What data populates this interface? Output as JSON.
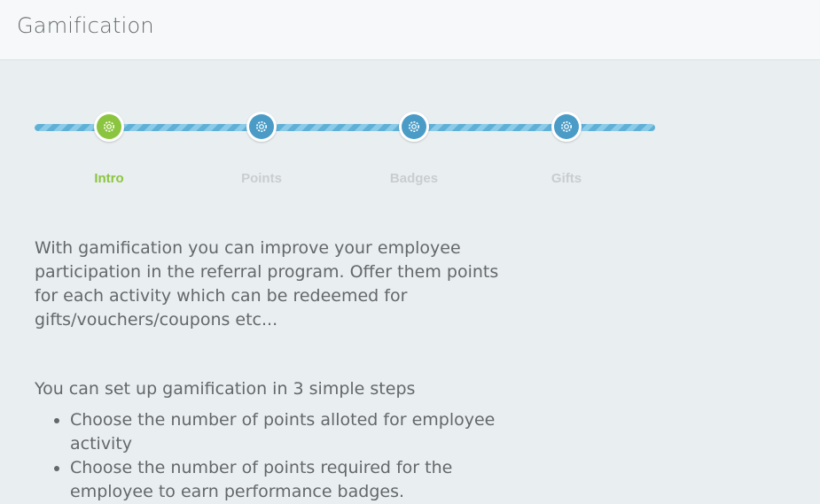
{
  "header": {
    "title": "Gamification"
  },
  "wizard": {
    "steps": [
      {
        "label": "Intro",
        "icon": "gear-icon",
        "active": true
      },
      {
        "label": "Points",
        "icon": "gear-icon",
        "active": false
      },
      {
        "label": "Badges",
        "icon": "gear-icon",
        "active": false
      },
      {
        "label": "Gifts",
        "icon": "gear-icon",
        "active": false
      }
    ],
    "colors": {
      "active": "#8bc53f",
      "inactive": "#4a9cc7",
      "inactive_label": "#c9cdd0"
    }
  },
  "content": {
    "intro": "With gamification you can improve your employee participation in the referral program. Offer them points for each activity which can be redeemed for gifts/vouchers/coupons etc...",
    "steps_intro": "You can set up gamification in 3 simple steps",
    "bullets": [
      "Choose the number of points alloted for employee activity",
      "Choose the number of points required for the employee to earn performance badges."
    ]
  }
}
